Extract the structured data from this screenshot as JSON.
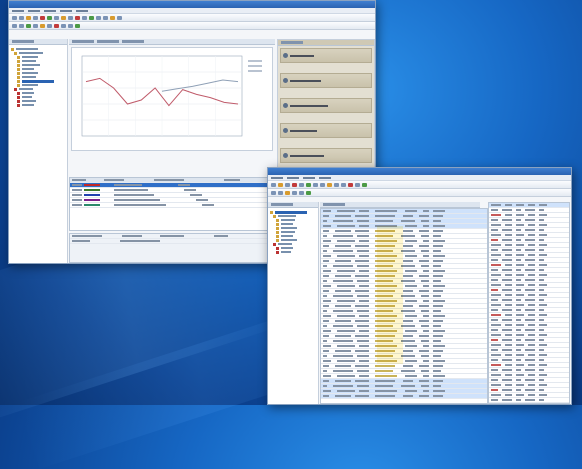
{
  "background": {
    "accent": "#1667c4",
    "deep": "#072e6b"
  },
  "window_1": {
    "chart_data": {
      "type": "line",
      "series": [
        {
          "values": [
            68,
            72,
            60,
            40,
            45,
            60,
            38,
            58,
            52,
            48,
            42,
            40
          ]
        },
        {
          "values": [
            56,
            59,
            62,
            66,
            70,
            68
          ]
        }
      ],
      "series_colors": [
        "#c05b6a",
        "#8fa0b6"
      ]
    },
    "side_items": [
      {},
      {},
      {},
      {},
      {},
      {},
      {}
    ],
    "legend_colors": [
      "#c02828",
      "#3a7a2a",
      "#2040b0",
      "#7a1f8a",
      "#2a8a6a"
    ]
  },
  "window_2": {
    "row_count": 38
  }
}
